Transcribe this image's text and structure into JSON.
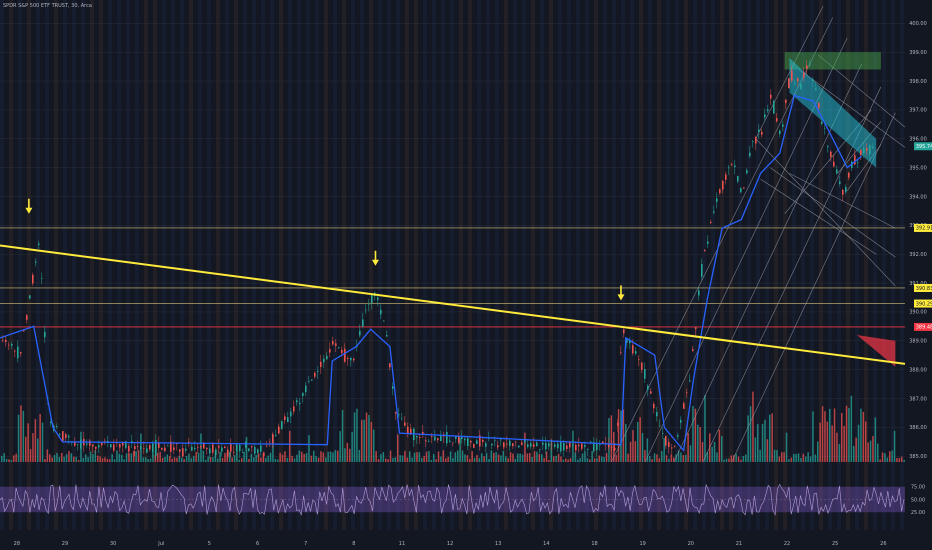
{
  "header": {
    "symbol": "SPDR S&P 500 ETF TRUST, 30, Arca"
  },
  "colors": {
    "background": "#131722",
    "band_a": "#1a2238",
    "band_b": "#302628",
    "trendline": "#ffeb3b",
    "arrow": "#ffeb3b",
    "hline": "#d9c27a",
    "redline": "#f23645",
    "up": "#26a69a",
    "down": "#ef5350",
    "ma": "#2962ff",
    "rsi_band": "#7e57c2",
    "rsi_line": "#b39ddb",
    "channel": "#9aa0ae"
  },
  "icons": [
    "down-arrow-icon"
  ],
  "chart_data": {
    "type": "candlestick",
    "price_axis": {
      "ticks": [
        "400.00",
        "399.00",
        "398.00",
        "397.00",
        "396.00",
        "395.00",
        "394.00",
        "393.00",
        "392.00",
        "391.00",
        "390.00",
        "389.00",
        "388.00",
        "387.00",
        "386.00",
        "385.00"
      ],
      "ylim": [
        384.8,
        400.6
      ]
    },
    "price_badges": [
      {
        "label": "392.91",
        "value": 392.91,
        "color": "#ffeb3b"
      },
      {
        "label": "390.83",
        "value": 390.83,
        "color": "#ffeb3b"
      },
      {
        "label": "390.29",
        "value": 390.29,
        "color": "#ffeb3b"
      },
      {
        "label": "389.48",
        "value": 389.48,
        "color": "#f23645"
      },
      {
        "label": "395.74",
        "value": 395.74,
        "color": "#26a69a"
      }
    ],
    "rsi_axis": {
      "ticks": [
        "75.00",
        "50.00",
        "25.00"
      ],
      "ylim": [
        0,
        100
      ],
      "band": [
        25,
        75
      ]
    },
    "time_axis": {
      "labels": [
        "28",
        "29",
        "30",
        "Jul",
        "5",
        "6",
        "7",
        "8",
        "11",
        "12",
        "13",
        "14",
        "18",
        "19",
        "20",
        "21",
        "22",
        "25",
        "26"
      ],
      "xlim": [
        0,
        18.8
      ]
    },
    "trendline": {
      "points": [
        [
          0,
          392.3
        ],
        [
          18.8,
          388.2
        ]
      ]
    },
    "horizontal_levels": [
      392.91,
      390.83,
      390.29,
      389.48
    ],
    "arrows": [
      {
        "x": 0.6,
        "price": 393.4
      },
      {
        "x": 7.8,
        "price": 391.6
      },
      {
        "x": 12.9,
        "price": 390.4
      }
    ],
    "price_path": [
      [
        0.0,
        389.2
      ],
      [
        0.4,
        388.5
      ],
      [
        0.6,
        390.5
      ],
      [
        0.8,
        392.4
      ],
      [
        0.9,
        389.7
      ],
      [
        1.0,
        386.2
      ],
      [
        1.5,
        385.5
      ],
      [
        3.0,
        385.3
      ],
      [
        5.5,
        385.2
      ],
      [
        6.6,
        388.0
      ],
      [
        6.9,
        388.9
      ],
      [
        7.3,
        388.2
      ],
      [
        7.6,
        390.2
      ],
      [
        7.8,
        390.6
      ],
      [
        8.0,
        389.4
      ],
      [
        8.2,
        386.5
      ],
      [
        8.6,
        385.7
      ],
      [
        10.5,
        385.4
      ],
      [
        12.8,
        385.3
      ],
      [
        12.9,
        389.5
      ],
      [
        13.3,
        388.2
      ],
      [
        13.8,
        385.6
      ],
      [
        14.0,
        385.2
      ],
      [
        14.3,
        387.6
      ],
      [
        14.6,
        392.0
      ],
      [
        14.8,
        393.5
      ],
      [
        15.0,
        394.4
      ],
      [
        15.2,
        395.3
      ],
      [
        15.4,
        394.0
      ],
      [
        15.6,
        395.7
      ],
      [
        15.8,
        396.2
      ],
      [
        16.0,
        397.5
      ],
      [
        16.2,
        396.1
      ],
      [
        16.4,
        398.3
      ],
      [
        16.6,
        397.8
      ],
      [
        16.8,
        398.6
      ],
      [
        17.0,
        397.0
      ],
      [
        17.2,
        395.7
      ],
      [
        17.5,
        394.1
      ],
      [
        17.7,
        395.2
      ],
      [
        18.0,
        395.7
      ],
      [
        18.2,
        395.5
      ]
    ],
    "ma_path": [
      [
        0.0,
        389.1
      ],
      [
        0.7,
        389.5
      ],
      [
        1.1,
        386.0
      ],
      [
        1.3,
        385.5
      ],
      [
        6.8,
        385.4
      ],
      [
        6.9,
        388.3
      ],
      [
        7.4,
        388.8
      ],
      [
        7.7,
        389.4
      ],
      [
        8.1,
        388.8
      ],
      [
        8.3,
        385.8
      ],
      [
        12.9,
        385.4
      ],
      [
        13.0,
        389.1
      ],
      [
        13.6,
        388.5
      ],
      [
        13.8,
        386.0
      ],
      [
        14.2,
        385.2
      ],
      [
        14.4,
        387.6
      ],
      [
        14.7,
        390.5
      ],
      [
        15.0,
        392.9
      ],
      [
        15.4,
        393.2
      ],
      [
        15.8,
        394.8
      ],
      [
        16.2,
        395.5
      ],
      [
        16.5,
        397.5
      ],
      [
        16.9,
        397.3
      ],
      [
        17.3,
        396.0
      ],
      [
        17.6,
        395.0
      ],
      [
        17.9,
        395.4
      ]
    ],
    "shapes": {
      "target_box": {
        "x": [
          16.3,
          18.3
        ],
        "y": [
          398.4,
          399.0
        ],
        "color": "#4caf50"
      },
      "down_channel": {
        "top": [
          [
            16.4,
            398.8
          ],
          [
            18.2,
            396.0
          ]
        ],
        "bottom": [
          [
            16.4,
            397.6
          ],
          [
            18.2,
            395.0
          ]
        ],
        "color": "#26c6da"
      },
      "red_triangle": {
        "points": [
          [
            17.8,
            389.2
          ],
          [
            18.6,
            389.0
          ],
          [
            18.6,
            388.1
          ]
        ],
        "color": "#f23645"
      },
      "fan_lines": [
        [
          [
            12.7,
            384.8
          ],
          [
            17.3,
            400.2
          ]
        ],
        [
          [
            13.4,
            384.8
          ],
          [
            17.6,
            399.5
          ]
        ],
        [
          [
            14.0,
            384.8
          ],
          [
            17.9,
            398.6
          ]
        ],
        [
          [
            14.6,
            384.8
          ],
          [
            18.3,
            397.8
          ]
        ],
        [
          [
            15.2,
            384.8
          ],
          [
            18.6,
            396.9
          ]
        ],
        [
          [
            15.7,
            396.0
          ],
          [
            17.1,
            400.6
          ]
        ],
        [
          [
            15.7,
            396.0
          ],
          [
            18.6,
            390.9
          ]
        ],
        [
          [
            16.0,
            395.0
          ],
          [
            18.6,
            391.9
          ]
        ],
        [
          [
            16.4,
            394.8
          ],
          [
            18.6,
            392.9
          ]
        ],
        [
          [
            15.8,
            394.6
          ],
          [
            18.2,
            392.0
          ]
        ],
        [
          [
            16.6,
            398.4
          ],
          [
            18.8,
            395.7
          ]
        ],
        [
          [
            17.0,
            398.9
          ],
          [
            18.8,
            396.4
          ]
        ],
        [
          [
            16.3,
            393.4
          ],
          [
            18.1,
            397.0
          ]
        ],
        [
          [
            17.4,
            394.8
          ],
          [
            18.3,
            396.6
          ]
        ],
        [
          [
            17.6,
            394.2
          ],
          [
            18.3,
            395.8
          ]
        ]
      ]
    }
  }
}
